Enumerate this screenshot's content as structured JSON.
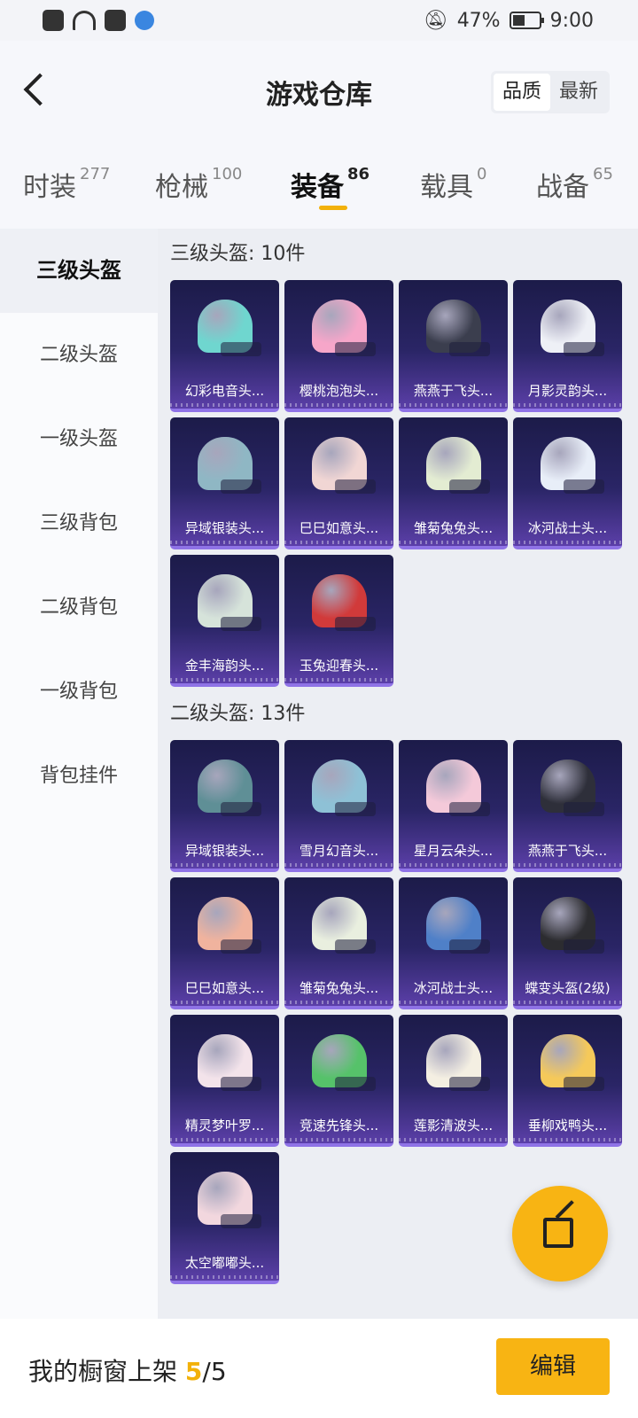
{
  "status_bar": {
    "battery": "47%",
    "battery_level": 0.47,
    "time": "9:00"
  },
  "header": {
    "title": "游戏仓库",
    "sort_options": [
      "品质",
      "最新"
    ],
    "sort_selected": "品质"
  },
  "tabs": [
    {
      "label": "时装",
      "count": "277"
    },
    {
      "label": "枪械",
      "count": "100"
    },
    {
      "label": "装备",
      "count": "86",
      "active": true
    },
    {
      "label": "载具",
      "count": "0"
    },
    {
      "label": "战备",
      "count": "65"
    }
  ],
  "side_menu": [
    "三级头盔",
    "二级头盔",
    "一级头盔",
    "三级背包",
    "二级背包",
    "一级背包",
    "背包挂件"
  ],
  "sections": [
    {
      "title": "三级头盔: 10件",
      "items": [
        {
          "name": "幻彩电音头...",
          "color": "#6fd6cf"
        },
        {
          "name": "樱桃泡泡头...",
          "color": "#f6a6c9"
        },
        {
          "name": "燕燕于飞头...",
          "color": "#3b3e4e"
        },
        {
          "name": "月影灵韵头...",
          "color": "#eef0f6"
        },
        {
          "name": "异域银装头...",
          "color": "#8fb7c4"
        },
        {
          "name": "巳巳如意头...",
          "color": "#f1d6d4"
        },
        {
          "name": "雏菊兔兔头...",
          "color": "#e3ecd2"
        },
        {
          "name": "冰河战士头...",
          "color": "#e8eef8"
        },
        {
          "name": "金丰海韵头...",
          "color": "#d6e3da"
        },
        {
          "name": "玉兔迎春头...",
          "color": "#d13a3a"
        }
      ]
    },
    {
      "title": "二级头盔: 13件",
      "items": [
        {
          "name": "异域银装头...",
          "color": "#5f8f96"
        },
        {
          "name": "雪月幻音头...",
          "color": "#8ec1d6"
        },
        {
          "name": "星月云朵头...",
          "color": "#f4c9d9"
        },
        {
          "name": "燕燕于飞头...",
          "color": "#2e2f3a"
        },
        {
          "name": "巳巳如意头...",
          "color": "#f0b39e"
        },
        {
          "name": "雏菊兔兔头...",
          "color": "#e9efdf"
        },
        {
          "name": "冰河战士头...",
          "color": "#4f80c8"
        },
        {
          "name": "蝶变头盔(2级)",
          "color": "#2c2c30"
        },
        {
          "name": "精灵梦叶罗...",
          "color": "#f3e3ea"
        },
        {
          "name": "竞速先锋头...",
          "color": "#56c26a"
        },
        {
          "name": "莲影清波头...",
          "color": "#f4efe2"
        },
        {
          "name": "垂柳戏鸭头...",
          "color": "#f5c95a"
        },
        {
          "name": "太空嘟嘟头...",
          "color": "#f2d7de"
        }
      ]
    }
  ],
  "bottom": {
    "shelf_label": "我的橱窗上架",
    "shelf_current": "5",
    "shelf_total": "/5",
    "edit_label": "编辑"
  },
  "accent_color": "#f8b413"
}
